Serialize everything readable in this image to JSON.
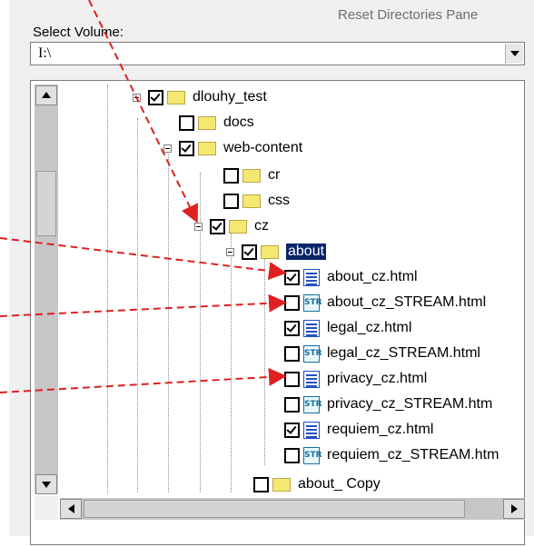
{
  "header": {
    "reset_label": "Reset Directories Pane",
    "select_volume_label": "Select Volume:"
  },
  "volume": {
    "selected": "I:\\"
  },
  "tree": {
    "root": {
      "label": "dlouhy_test",
      "checked": true
    },
    "docs": {
      "label": "docs",
      "checked": false
    },
    "web_content": {
      "label": "web-content",
      "checked": true
    },
    "cr": {
      "label": "cr",
      "checked": false
    },
    "css": {
      "label": "css",
      "checked": false
    },
    "cz": {
      "label": "cz",
      "checked": true
    },
    "about": {
      "label": "about",
      "checked": true,
      "selected": true
    },
    "files": [
      {
        "label": "about_cz.html",
        "checked": true,
        "icon": "html-file-icon"
      },
      {
        "label": "about_cz_STREAM.html",
        "checked": false,
        "icon": "stream-file-icon"
      },
      {
        "label": "legal_cz.html",
        "checked": true,
        "icon": "html-file-icon"
      },
      {
        "label": "legal_cz_STREAM.html",
        "checked": false,
        "icon": "stream-file-icon"
      },
      {
        "label": "privacy_cz.html",
        "checked": false,
        "icon": "html-file-icon"
      },
      {
        "label": "privacy_cz_STREAM.htm",
        "checked": false,
        "icon": "stream-file-icon"
      },
      {
        "label": "requiem_cz.html",
        "checked": true,
        "icon": "html-file-icon"
      },
      {
        "label": "requiem_cz_STREAM.htm",
        "checked": false,
        "icon": "stream-file-icon"
      }
    ],
    "about_copy": {
      "label": "about_ Copy",
      "checked": false
    }
  },
  "stream_icon_text": "STR",
  "colors": {
    "arrow": "#e02020",
    "selection": "#0a246a",
    "folder": "#f5e870"
  }
}
